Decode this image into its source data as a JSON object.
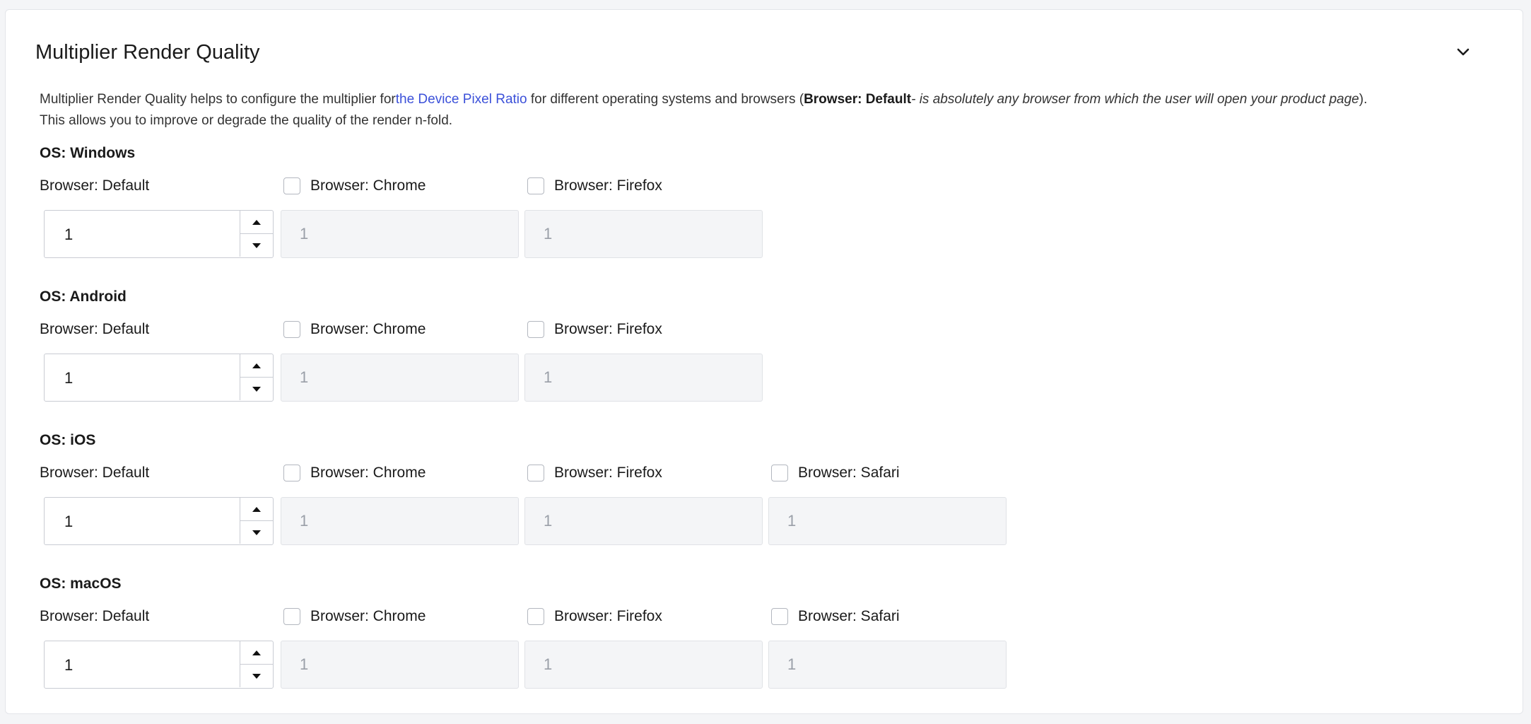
{
  "panel": {
    "title": "Multiplier Render Quality",
    "collapse_icon": "chevron-down-icon"
  },
  "description": {
    "part1": "Multiplier Render Quality helps to configure the multiplier for",
    "link": "the Device Pixel Ratio",
    "part2": " for different operating systems and browsers (",
    "bold": "Browser: Default",
    "italic_prefix": "- ",
    "italic": "is absolutely any browser from which the user will open your product page",
    "part3": ").",
    "line2": "This allows you to improve or degrade the quality of the render n-fold.",
    "link_color": "#3b50d9"
  },
  "sections": [
    {
      "os": "OS: Windows",
      "default_label": "Browser: Default",
      "default_value": "1",
      "browsers": [
        {
          "label": "Browser: Chrome",
          "value": "1",
          "checked": false
        },
        {
          "label": "Browser: Firefox",
          "value": "1",
          "checked": false
        }
      ]
    },
    {
      "os": "OS: Android",
      "default_label": "Browser: Default",
      "default_value": "1",
      "browsers": [
        {
          "label": "Browser: Chrome",
          "value": "1",
          "checked": false
        },
        {
          "label": "Browser: Firefox",
          "value": "1",
          "checked": false
        }
      ]
    },
    {
      "os": "OS: iOS",
      "default_label": "Browser: Default",
      "default_value": "1",
      "browsers": [
        {
          "label": "Browser: Chrome",
          "value": "1",
          "checked": false
        },
        {
          "label": "Browser: Firefox",
          "value": "1",
          "checked": false
        },
        {
          "label": "Browser: Safari",
          "value": "1",
          "checked": false
        }
      ]
    },
    {
      "os": "OS: macOS",
      "default_label": "Browser: Default",
      "default_value": "1",
      "browsers": [
        {
          "label": "Browser: Chrome",
          "value": "1",
          "checked": false
        },
        {
          "label": "Browser: Firefox",
          "value": "1",
          "checked": false
        },
        {
          "label": "Browser: Safari",
          "value": "1",
          "checked": false
        }
      ]
    }
  ]
}
